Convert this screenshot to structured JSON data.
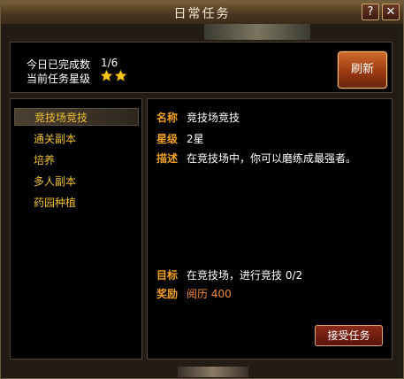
{
  "window": {
    "title": "日常任务",
    "help_label": "?",
    "close_label": "✕"
  },
  "summary": {
    "completed_label": "今日已完成数",
    "completed_value": "1/6",
    "star_label": "当前任务星级",
    "star_count": 2,
    "star_color": "#f5c518"
  },
  "refresh_label": "刷新",
  "tasks": [
    {
      "label": "竞技场竞技",
      "selected": true
    },
    {
      "label": "通关副本",
      "selected": false
    },
    {
      "label": "培养",
      "selected": false
    },
    {
      "label": "多人副本",
      "selected": false
    },
    {
      "label": "药园种植",
      "selected": false
    }
  ],
  "detail": {
    "name_label": "名称",
    "name_value": "竞技场竞技",
    "level_label": "星级",
    "level_value": "2星",
    "desc_label": "描述",
    "desc_value": "在竞技场中，你可以磨练成最强者。",
    "goal_label": "目标",
    "goal_value": "在竞技场，进行竞技 0/2",
    "reward_label": "奖励",
    "reward_value": "阅历 400"
  },
  "accept_label": "接受任务",
  "colors": {
    "task_text": "#f0c030",
    "field_label": "#f0a020",
    "reward_text": "#f08c38"
  }
}
